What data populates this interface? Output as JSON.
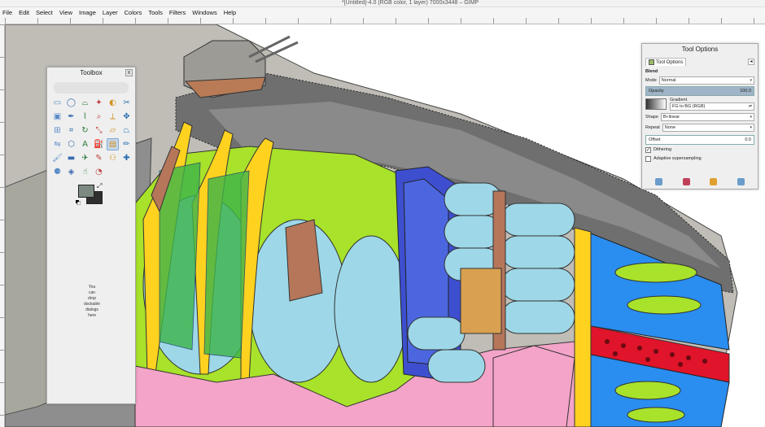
{
  "window": {
    "title": "*[Untitled]-4.0 (RGB color, 1 layer) 7000x3448 – GIMP"
  },
  "menu": [
    "File",
    "Edit",
    "Select",
    "View",
    "Image",
    "Layer",
    "Colors",
    "Tools",
    "Filters",
    "Windows",
    "Help"
  ],
  "toolbox": {
    "title": "Toolbox",
    "tools": [
      "rect-select-icon",
      "ellipse-select-icon",
      "free-select-icon",
      "fuzzy-select-icon",
      "color-select-icon",
      "scissors-icon",
      "foreground-select-icon",
      "paths-icon",
      "color-picker-icon",
      "zoom-icon",
      "measure-icon",
      "move-icon",
      "align-icon",
      "crop-icon",
      "rotate-icon",
      "scale-icon",
      "shear-icon",
      "perspective-icon",
      "flip-icon",
      "cage-icon",
      "text-icon",
      "bucket-fill-icon",
      "blend-icon",
      "pencil-icon",
      "paintbrush-icon",
      "eraser-icon",
      "airbrush-icon",
      "ink-icon",
      "clone-icon",
      "heal-icon",
      "perspective-clone-icon",
      "blur-icon",
      "smudge-icon",
      "dodge-burn-icon"
    ],
    "active_tool_index": 22,
    "colors": {
      "foreground": "#7d8a82",
      "background": "#2e2e2e"
    },
    "drop_hint": [
      "You",
      "can",
      "drop",
      "dockable",
      "dialogs",
      "here"
    ]
  },
  "tool_options": {
    "title": "Tool Options",
    "tab_label": "Tool Options",
    "section": "Blend",
    "mode_label": "Mode",
    "mode_value": "Normal",
    "opacity_label": "Opacity",
    "opacity_value": "100.0",
    "gradient_label": "Gradient",
    "gradient_value": "FG to BG (RGB)",
    "shape_label": "Shape",
    "shape_value": "Bi-linear",
    "repeat_label": "Repeat",
    "repeat_value": "None",
    "offset_label": "Offset",
    "offset_value": "0.0",
    "dithering_label": "Dithering",
    "dithering_checked": true,
    "adaptive_label": "Adaptive supersampling",
    "adaptive_checked": false
  }
}
